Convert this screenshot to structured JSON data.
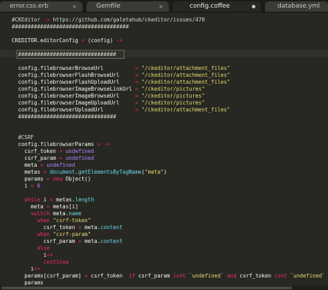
{
  "tabs": [
    {
      "label": "error.css.erb",
      "active": false,
      "close": "×"
    },
    {
      "label": "Gemfile",
      "active": false,
      "close": "×"
    },
    {
      "label": "config.coffee",
      "active": true,
      "close": ""
    },
    {
      "label": "database.yml",
      "active": false,
      "close": "×"
    }
  ],
  "colors": {
    "background": "#272822",
    "plain": "#f8f8f2",
    "comment": "#d8d8d0",
    "keyword": "#f92672",
    "string": "#e6db74",
    "function": "#a6e22e",
    "constant": "#ae81ff",
    "builtin": "#66d9ef"
  },
  "code": [
    [
      {
        "t": "#CKEditor ",
        "c": "comment"
      },
      {
        "t": "->",
        "c": "keyword"
      },
      {
        "t": " https://github.com/galetahub/ckeditor/issues/470",
        "c": "comment"
      }
    ],
    [
      {
        "t": "#####################################",
        "c": "comment"
      }
    ],
    [],
    [
      {
        "t": "CKEDITOR.editorConfig ",
        "c": "plain"
      },
      {
        "t": "=",
        "c": "keyword"
      },
      {
        "t": " (config) ",
        "c": "plain"
      },
      {
        "t": "->",
        "c": "keyword"
      }
    ],
    [],
    [
      {
        "t": "  ###############################",
        "c": "comment"
      }
    ],
    [],
    [
      {
        "t": "  config.filebrowserBrowseUrl          ",
        "c": "plain"
      },
      {
        "t": "=",
        "c": "keyword"
      },
      {
        "t": " \"/ckeditor/attachment_files\"",
        "c": "string"
      }
    ],
    [
      {
        "t": "  config.filebrowserFlashBrowseUrl     ",
        "c": "plain"
      },
      {
        "t": "=",
        "c": "keyword"
      },
      {
        "t": " \"/ckeditor/attachment_files\"",
        "c": "string"
      }
    ],
    [
      {
        "t": "  config.filebrowserFlashUploadUrl     ",
        "c": "plain"
      },
      {
        "t": "=",
        "c": "keyword"
      },
      {
        "t": " \"/ckeditor/attachment_files\"",
        "c": "string"
      }
    ],
    [
      {
        "t": "  config.filebrowserImageBrowseLinkUrl ",
        "c": "plain"
      },
      {
        "t": "=",
        "c": "keyword"
      },
      {
        "t": " \"/ckeditor/pictures\"",
        "c": "string"
      }
    ],
    [
      {
        "t": "  config.filebrowserImageBrowseUrl     ",
        "c": "plain"
      },
      {
        "t": "=",
        "c": "keyword"
      },
      {
        "t": " \"/ckeditor/pictures\"",
        "c": "string"
      }
    ],
    [
      {
        "t": "  config.filebrowserImageUploadUrl     ",
        "c": "plain"
      },
      {
        "t": "=",
        "c": "keyword"
      },
      {
        "t": " \"/ckeditor/pictures\"",
        "c": "string"
      }
    ],
    [
      {
        "t": "  config.filebrowserUploadUrl          ",
        "c": "plain"
      },
      {
        "t": "=",
        "c": "keyword"
      },
      {
        "t": " \"/ckeditor/attachment_files\"",
        "c": "string"
      }
    ],
    [
      {
        "t": "  ###############################",
        "c": "comment"
      }
    ],
    [],
    [],
    [
      {
        "t": "  #CSRF",
        "c": "comment"
      }
    ],
    [
      {
        "t": "  config.filebrowserParams ",
        "c": "plain"
      },
      {
        "t": "=",
        "c": "keyword"
      },
      {
        "t": " ",
        "c": "plain"
      },
      {
        "t": "->",
        "c": "keyword"
      }
    ],
    [
      {
        "t": "    csrf_token ",
        "c": "plain"
      },
      {
        "t": "=",
        "c": "keyword"
      },
      {
        "t": " ",
        "c": "plain"
      },
      {
        "t": "undefined",
        "c": "constant"
      }
    ],
    [
      {
        "t": "    csrf_param ",
        "c": "plain"
      },
      {
        "t": "=",
        "c": "keyword"
      },
      {
        "t": " ",
        "c": "plain"
      },
      {
        "t": "undefined",
        "c": "constant"
      }
    ],
    [
      {
        "t": "    meta ",
        "c": "plain"
      },
      {
        "t": "=",
        "c": "keyword"
      },
      {
        "t": " ",
        "c": "plain"
      },
      {
        "t": "undefined",
        "c": "constant"
      }
    ],
    [
      {
        "t": "    metas ",
        "c": "plain"
      },
      {
        "t": "=",
        "c": "keyword"
      },
      {
        "t": " ",
        "c": "plain"
      },
      {
        "t": "document",
        "c": "builtin"
      },
      {
        "t": ".",
        "c": "plain"
      },
      {
        "t": "getElementsByTagName",
        "c": "builtin"
      },
      {
        "t": "(",
        "c": "plain"
      },
      {
        "t": "\"meta\"",
        "c": "string"
      },
      {
        "t": ")",
        "c": "plain"
      }
    ],
    [
      {
        "t": "    params ",
        "c": "plain"
      },
      {
        "t": "=",
        "c": "keyword"
      },
      {
        "t": " ",
        "c": "plain"
      },
      {
        "t": "new",
        "c": "keyword"
      },
      {
        "t": " Object()",
        "c": "plain"
      }
    ],
    [
      {
        "t": "    i ",
        "c": "plain"
      },
      {
        "t": "=",
        "c": "keyword"
      },
      {
        "t": " ",
        "c": "plain"
      },
      {
        "t": "0",
        "c": "constant"
      }
    ],
    [],
    [
      {
        "t": "    ",
        "c": "plain"
      },
      {
        "t": "while",
        "c": "keyword"
      },
      {
        "t": " i ",
        "c": "plain"
      },
      {
        "t": "<",
        "c": "keyword"
      },
      {
        "t": " metas.",
        "c": "plain"
      },
      {
        "t": "length",
        "c": "builtin"
      }
    ],
    [
      {
        "t": "      meta ",
        "c": "plain"
      },
      {
        "t": "=",
        "c": "keyword"
      },
      {
        "t": " metas[i]",
        "c": "plain"
      }
    ],
    [
      {
        "t": "      ",
        "c": "plain"
      },
      {
        "t": "switch",
        "c": "keyword"
      },
      {
        "t": " meta.",
        "c": "plain"
      },
      {
        "t": "name",
        "c": "builtin"
      }
    ],
    [
      {
        "t": "        ",
        "c": "plain"
      },
      {
        "t": "when",
        "c": "keyword"
      },
      {
        "t": " ",
        "c": "plain"
      },
      {
        "t": "\"csrf-token\"",
        "c": "string"
      }
    ],
    [
      {
        "t": "          csrf_token ",
        "c": "plain"
      },
      {
        "t": "=",
        "c": "keyword"
      },
      {
        "t": " meta.",
        "c": "plain"
      },
      {
        "t": "content",
        "c": "builtin"
      }
    ],
    [
      {
        "t": "        ",
        "c": "plain"
      },
      {
        "t": "when",
        "c": "keyword"
      },
      {
        "t": " ",
        "c": "plain"
      },
      {
        "t": "\"csrf-param\"",
        "c": "string"
      }
    ],
    [
      {
        "t": "          csrf_param ",
        "c": "plain"
      },
      {
        "t": "=",
        "c": "keyword"
      },
      {
        "t": " meta.",
        "c": "plain"
      },
      {
        "t": "content",
        "c": "builtin"
      }
    ],
    [
      {
        "t": "        ",
        "c": "plain"
      },
      {
        "t": "else",
        "c": "keyword"
      }
    ],
    [
      {
        "t": "          i",
        "c": "plain"
      },
      {
        "t": "++",
        "c": "keyword"
      }
    ],
    [
      {
        "t": "          ",
        "c": "plain"
      },
      {
        "t": "continue",
        "c": "keyword"
      }
    ],
    [
      {
        "t": "      i",
        "c": "plain"
      },
      {
        "t": "++",
        "c": "keyword"
      }
    ],
    [
      {
        "t": "    params[csrf_param] ",
        "c": "plain"
      },
      {
        "t": "=",
        "c": "keyword"
      },
      {
        "t": " csrf_token  ",
        "c": "plain"
      },
      {
        "t": "if",
        "c": "keyword"
      },
      {
        "t": " csrf_param ",
        "c": "plain"
      },
      {
        "t": "isnt",
        "c": "keyword"
      },
      {
        "t": " ",
        "c": "plain"
      },
      {
        "t": "`undefined`",
        "c": "string"
      },
      {
        "t": " ",
        "c": "plain"
      },
      {
        "t": "and",
        "c": "keyword"
      },
      {
        "t": " csrf_token ",
        "c": "plain"
      },
      {
        "t": "isnt",
        "c": "keyword"
      },
      {
        "t": " ",
        "c": "plain"
      },
      {
        "t": "`undefined`",
        "c": "string"
      }
    ],
    [
      {
        "t": "    params",
        "c": "plain"
      }
    ]
  ]
}
